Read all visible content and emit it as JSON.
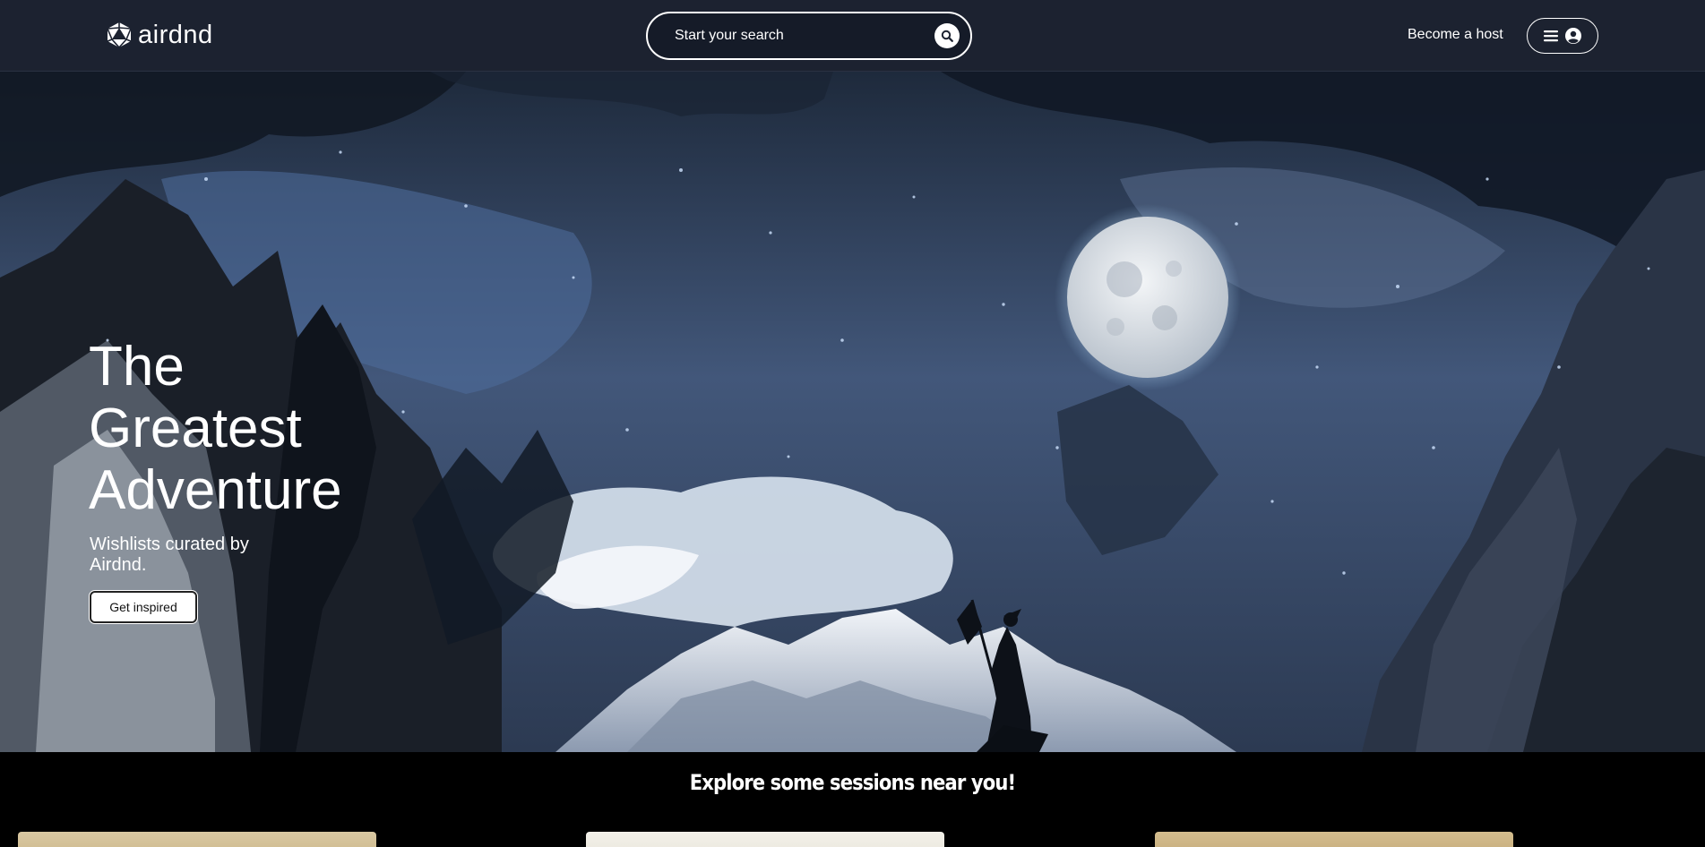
{
  "header": {
    "brand": "airdnd",
    "search_placeholder": "Start your search",
    "host_link": "Become a host",
    "icons": {
      "logo": "d20-die-icon",
      "search": "search-icon",
      "menu": "hamburger-menu-icon",
      "account": "user-circle-icon"
    }
  },
  "hero": {
    "title_lines": [
      "The",
      "Greatest",
      "Adventure"
    ],
    "subtitle": "Wishlists curated by Airdnd.",
    "cta_label": "Get inspired",
    "image": "moonlit-mountain-night-with-lone-flag-bearer"
  },
  "explore": {
    "heading": "Explore some sessions near you!",
    "cards": [
      "parchment-card",
      "light-paper-card",
      "parchment-card"
    ]
  },
  "colors": {
    "header_bg": "#1c2230",
    "page_bg": "#000000",
    "text": "#ffffff",
    "button_bg": "#ffffff"
  }
}
